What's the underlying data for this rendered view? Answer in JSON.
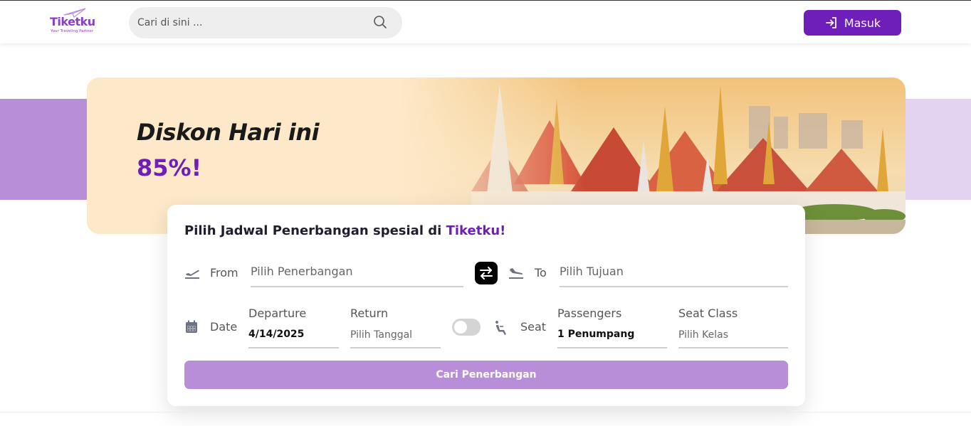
{
  "brand": {
    "name": "Tiketku",
    "tagline": "Your Traveling Partner",
    "accent": "#6f1fb9",
    "accent_light": "#b98ed9"
  },
  "search": {
    "placeholder": "Cari di sini ...",
    "icon": "search-icon"
  },
  "header": {
    "login_label": "Masuk",
    "login_icon": "login-icon"
  },
  "banner": {
    "title": "Diskon Hari ini",
    "value": "85%!"
  },
  "booking": {
    "heading_prefix": "Pilih Jadwal Penerbangan spesial di",
    "heading_brand": "Tiketku!",
    "from_label": "From",
    "from_placeholder": "Pilih Penerbangan",
    "to_label": "To",
    "to_placeholder": "Pilih Tujuan",
    "date_label": "Date",
    "departure_label": "Departure",
    "departure_value": "4/14/2025",
    "return_label": "Return",
    "return_placeholder": "Pilih Tanggal",
    "seat_label": "Seat",
    "passengers_label": "Passengers",
    "passengers_value": "1 Penumpang",
    "seat_class_label": "Seat Class",
    "seat_class_placeholder": "Pilih Kelas",
    "submit_label": "Cari Penerbangan",
    "return_toggle_on": false
  }
}
